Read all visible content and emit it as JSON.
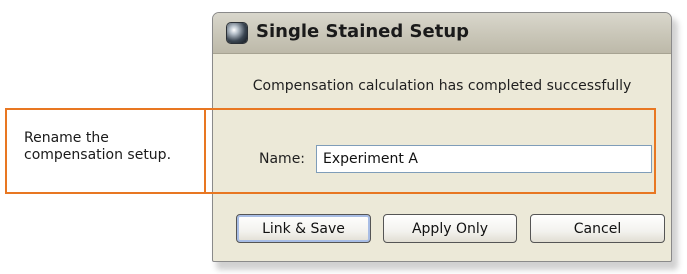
{
  "dialog": {
    "title": "Single Stained Setup",
    "message": "Compensation calculation has completed successfully",
    "name_label": "Name:",
    "name_value": "Experiment A",
    "buttons": {
      "link_save": "Link & Save",
      "apply_only": "Apply Only",
      "cancel": "Cancel"
    },
    "app_icon": "app-logo-icon"
  },
  "annotation": {
    "line1": "Rename the",
    "line2": "compensation setup.",
    "color": "#e87722"
  }
}
